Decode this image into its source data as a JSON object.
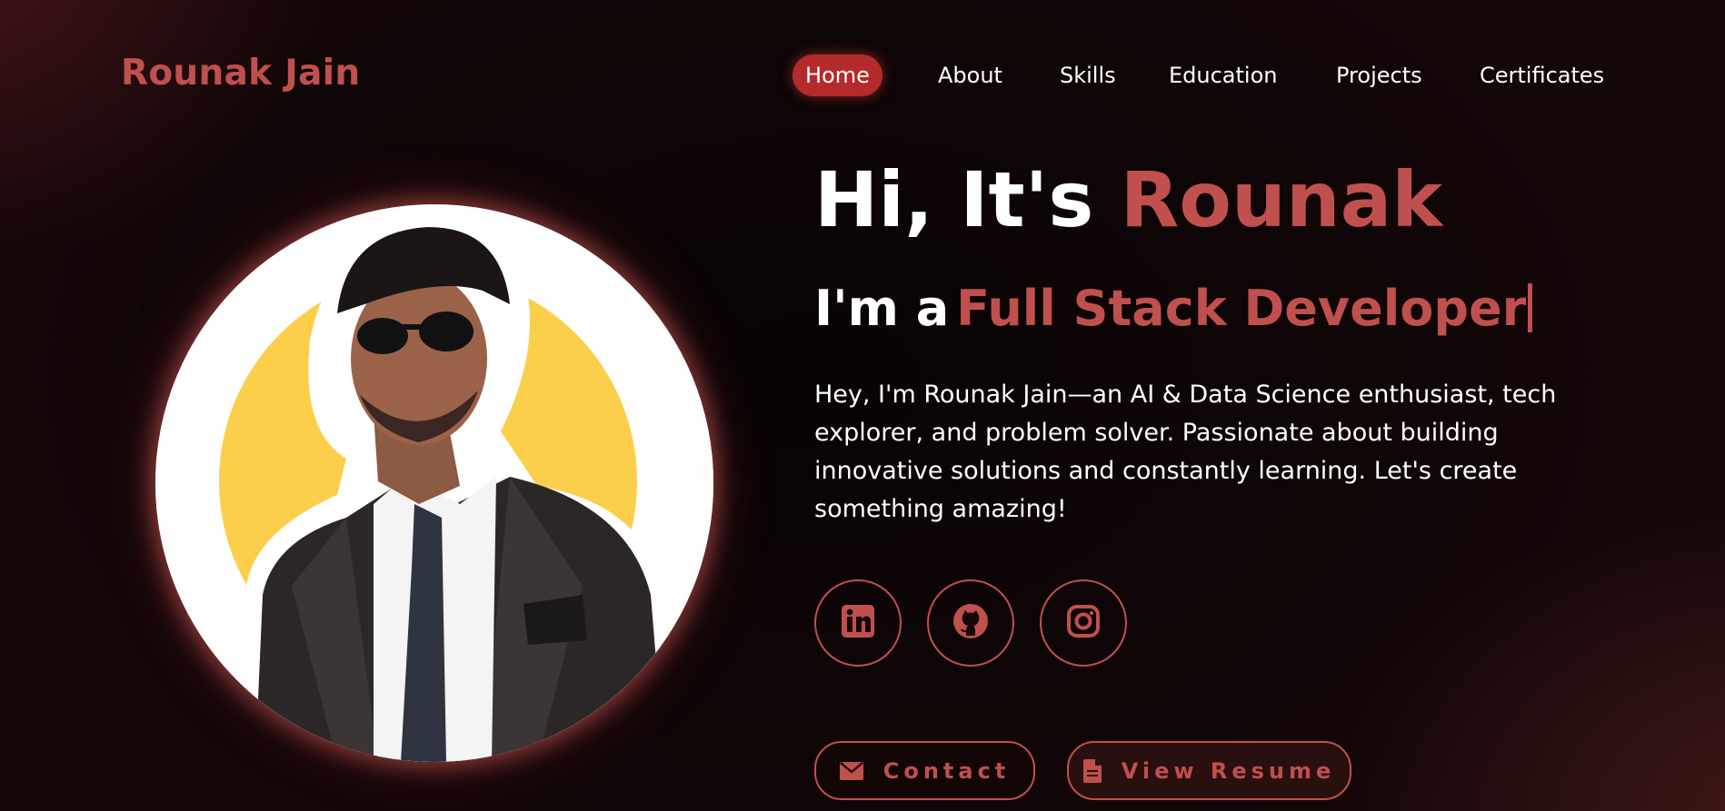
{
  "header": {
    "logo": "Rounak Jain",
    "nav": [
      {
        "label": "Home",
        "active": true
      },
      {
        "label": "About"
      },
      {
        "label": "Skills"
      },
      {
        "label": "Education"
      },
      {
        "label": "Projects"
      },
      {
        "label": "Certificates"
      }
    ]
  },
  "hero": {
    "greeting": "Hi, It's ",
    "name": "Rounak",
    "role_prefix": "I'm a",
    "role": "Full Stack Developer",
    "description": "Hey, I'm Rounak Jain—an AI & Data Science enthusiast, tech explorer, and problem solver. Passionate about building innovative solutions and constantly learning. Let's create something amazing!"
  },
  "social": [
    {
      "icon": "linkedin-icon"
    },
    {
      "icon": "github-icon"
    },
    {
      "icon": "instagram-icon"
    }
  ],
  "buttons": {
    "contact": {
      "label": "Contact",
      "icon": "envelope-icon"
    },
    "resume": {
      "label": "View Resume",
      "icon": "document-icon"
    }
  },
  "colors": {
    "accent": "#c0504d",
    "active_nav": "#b52a2b",
    "background": "#0a0405"
  }
}
